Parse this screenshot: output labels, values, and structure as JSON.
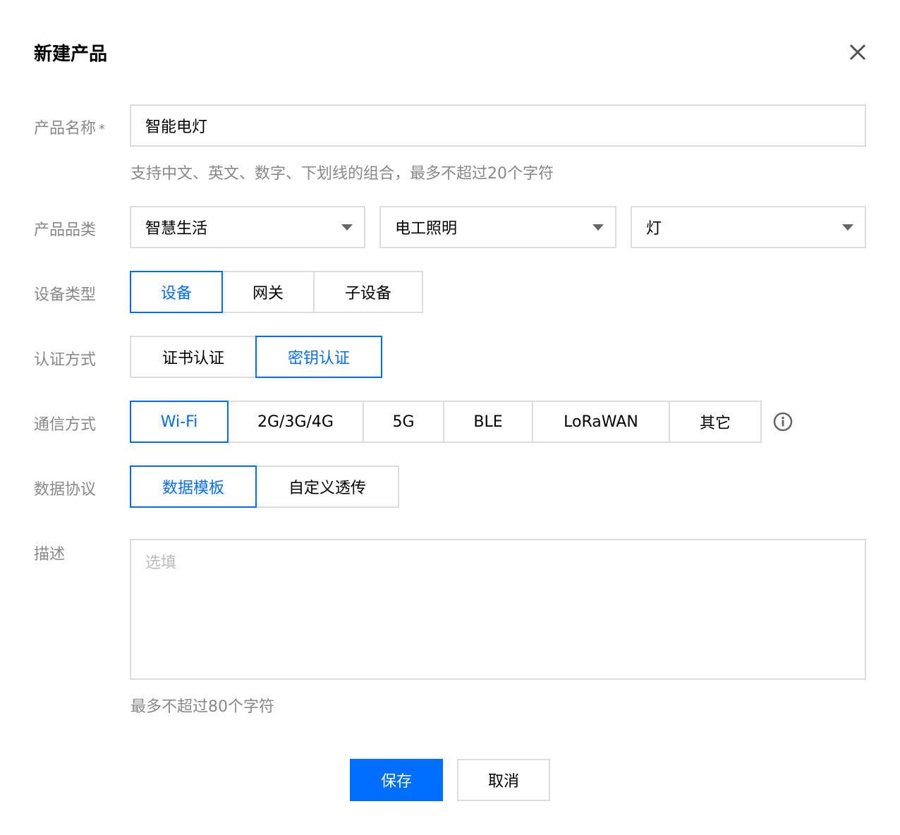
{
  "dialog": {
    "title": "新建产品"
  },
  "form": {
    "name": {
      "label": "产品名称",
      "required_mark": "*",
      "value": "智能电灯",
      "hint": "支持中文、英文、数字、下划线的组合，最多不超过20个字符"
    },
    "category": {
      "label": "产品品类",
      "level1": "智慧生活",
      "level2": "电工照明",
      "level3": "灯"
    },
    "device_type": {
      "label": "设备类型",
      "options": [
        "设备",
        "网关",
        "子设备"
      ],
      "selected": "设备"
    },
    "auth": {
      "label": "认证方式",
      "options": [
        "证书认证",
        "密钥认证"
      ],
      "selected": "密钥认证"
    },
    "comm": {
      "label": "通信方式",
      "options": [
        "Wi-Fi",
        "2G/3G/4G",
        "5G",
        "BLE",
        "LoRaWAN",
        "其它"
      ],
      "selected": "Wi-Fi"
    },
    "protocol": {
      "label": "数据协议",
      "options": [
        "数据模板",
        "自定义透传"
      ],
      "selected": "数据模板"
    },
    "description": {
      "label": "描述",
      "placeholder": "选填",
      "hint": "最多不超过80个字符"
    }
  },
  "actions": {
    "save": "保存",
    "cancel": "取消"
  },
  "colors": {
    "accent": "#006eff",
    "border": "#dcdcdc",
    "label": "#888888"
  },
  "icons": {
    "close": "close-icon",
    "info": "info-icon",
    "caret": "chevron-down-icon"
  }
}
